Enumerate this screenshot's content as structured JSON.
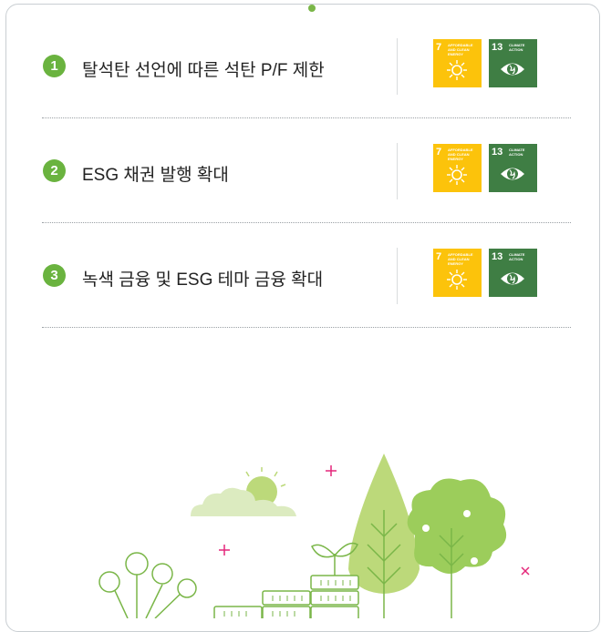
{
  "items": [
    {
      "number": "1",
      "label": "탈석탄 선언에 따른 석탄 P/F 제한",
      "sdgs": [
        {
          "number": "7",
          "title": "Affordable and Clean Energy",
          "icon": "sun-icon",
          "color": "#fcc30b"
        },
        {
          "number": "13",
          "title": "Climate Action",
          "icon": "eye-globe-icon",
          "color": "#3f7e44"
        }
      ]
    },
    {
      "number": "2",
      "label": "ESG 채권 발행 확대",
      "sdgs": [
        {
          "number": "7",
          "title": "Affordable and Clean Energy",
          "icon": "sun-icon",
          "color": "#fcc30b"
        },
        {
          "number": "13",
          "title": "Climate Action",
          "icon": "eye-globe-icon",
          "color": "#3f7e44"
        }
      ]
    },
    {
      "number": "3",
      "label": "녹색 금융 및 ESG 테마 금융 확대",
      "sdgs": [
        {
          "number": "7",
          "title": "Affordable and Clean Energy",
          "icon": "sun-icon",
          "color": "#fcc30b"
        },
        {
          "number": "13",
          "title": "Climate Action",
          "icon": "eye-globe-icon",
          "color": "#3f7e44"
        }
      ]
    }
  ],
  "colors": {
    "accent_green": "#6ab33f",
    "sdg7_yellow": "#fcc30b",
    "sdg13_green": "#3f7e44",
    "decor_plus_pink": "#e4277a"
  }
}
